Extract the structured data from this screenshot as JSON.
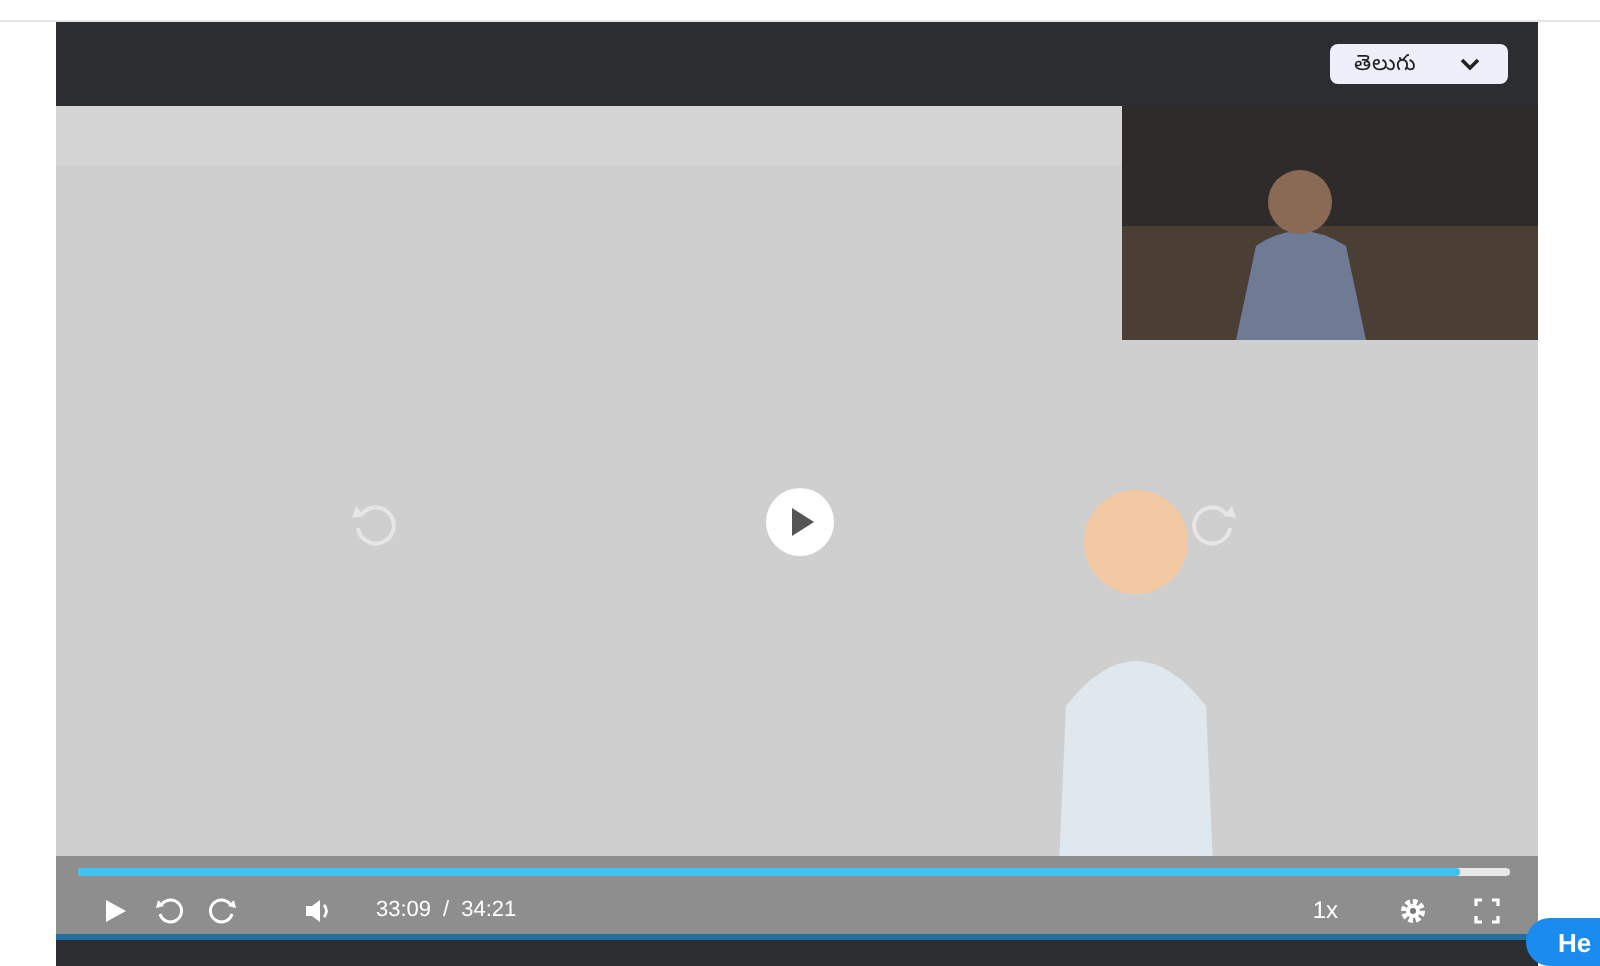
{
  "language_select": {
    "value": "తెలుగు"
  },
  "progress": {
    "level": 0.965
  },
  "controls": {
    "current_time": "33:09",
    "separator": "/",
    "duration": "34:21",
    "speed": "1x"
  },
  "help_button": {
    "label": "He"
  }
}
